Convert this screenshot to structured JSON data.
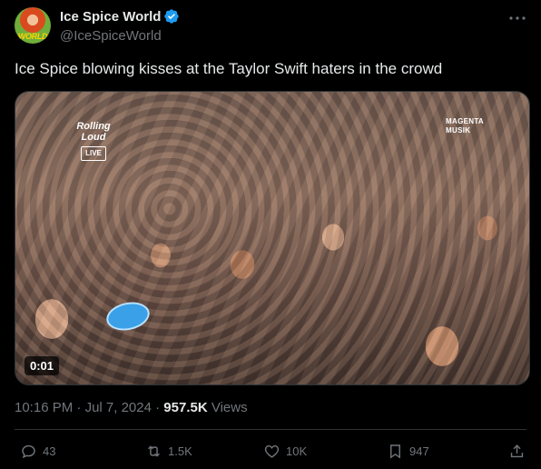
{
  "author": {
    "display_name": "Ice Spice World",
    "handle": "@IceSpiceWorld",
    "avatar_text": "WORLD",
    "verified": true
  },
  "tweet": {
    "text": "Ice Spice blowing kisses at the Taylor Swift haters in the crowd"
  },
  "video": {
    "overlay_logo_left": "Rolling Loud",
    "overlay_live": "LIVE",
    "overlay_logo_right_line1": "MAGENTA",
    "overlay_logo_right_line2": "MUSIK",
    "timestamp": "0:01"
  },
  "meta": {
    "time": "10:16 PM",
    "separator": "·",
    "date": "Jul 7, 2024",
    "views_count": "957.5K",
    "views_label": "Views"
  },
  "actions": {
    "replies": "43",
    "reposts": "1.5K",
    "likes": "10K",
    "bookmarks": "947"
  },
  "colors": {
    "background": "#000000",
    "text_primary": "#e7e9ea",
    "text_secondary": "#71767b",
    "verified_blue": "#1d9bf0",
    "divider": "#2f3336"
  }
}
